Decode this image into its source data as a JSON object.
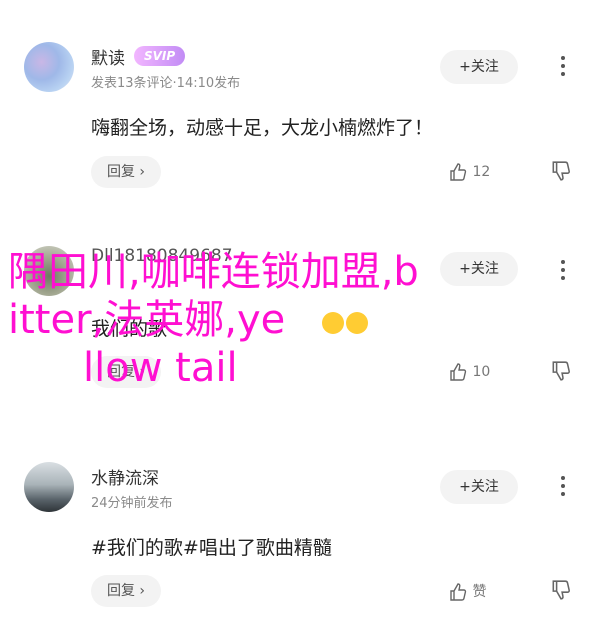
{
  "comments": [
    {
      "username": "默读",
      "badge": "SVIP",
      "meta": "发表13条评论·14:10发布",
      "follow": "+关注",
      "content": "嗨翻全场，动感十足，大龙小楠燃炸了！",
      "reply": "回复",
      "likes": "12"
    },
    {
      "username": "Dll18180849687",
      "meta": "",
      "follow": "+关注",
      "content": "我们的歌",
      "reply": "回复",
      "likes": "10"
    },
    {
      "username": "水静流深",
      "meta": "24分钟前发布",
      "follow": "+关注",
      "content": "#我们的歌#唱出了歌曲精髓",
      "reply": "回复",
      "likes": "赞"
    }
  ],
  "overlay": {
    "line1": "隅田川,咖啡连锁加盟,b",
    "line2": "itter,法英娜,ye",
    "line3": "llow tail"
  },
  "colors": {
    "overlay": "#ff0fd1",
    "svip": "#c28cf5",
    "button_bg": "#f3f3f3"
  }
}
